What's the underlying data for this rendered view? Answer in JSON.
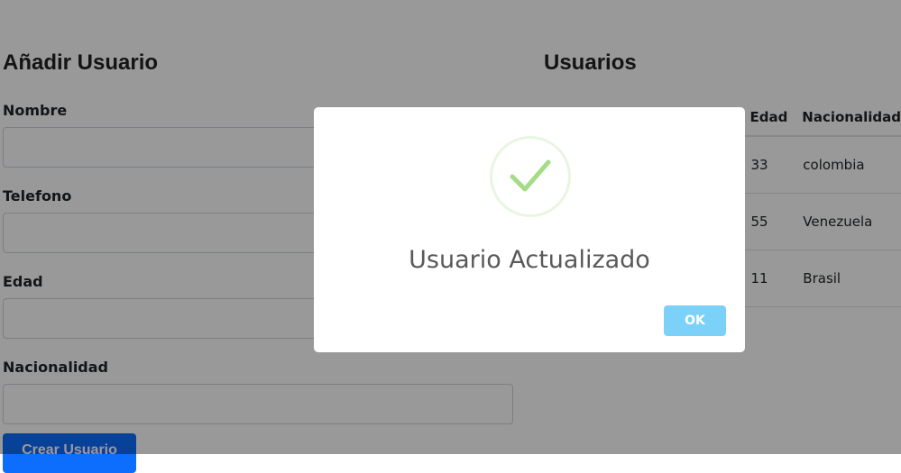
{
  "form": {
    "title": "Añadir Usuario",
    "fields": [
      {
        "label": "Nombre",
        "value": ""
      },
      {
        "label": "Telefono",
        "value": ""
      },
      {
        "label": "Edad",
        "value": ""
      },
      {
        "label": "Nacionalidad",
        "value": ""
      }
    ],
    "submit_label": "Crear Usuario"
  },
  "users": {
    "title": "Usuarios",
    "columns": [
      "Edad",
      "Nacionalidad"
    ],
    "rows": [
      {
        "edad": "33",
        "nacionalidad": "colombia"
      },
      {
        "edad": "55",
        "nacionalidad": "Venezuela"
      },
      {
        "edad": "11",
        "nacionalidad": "Brasil"
      }
    ]
  },
  "modal": {
    "icon": "success-check-icon",
    "title": "Usuario Actualizado",
    "ok_label": "OK"
  },
  "colors": {
    "overlay": "rgba(0,0,0,0.4)",
    "primary_button": "#0d6efd",
    "ok_button": "#7cd1f9",
    "success_check": "#a5dc86"
  }
}
